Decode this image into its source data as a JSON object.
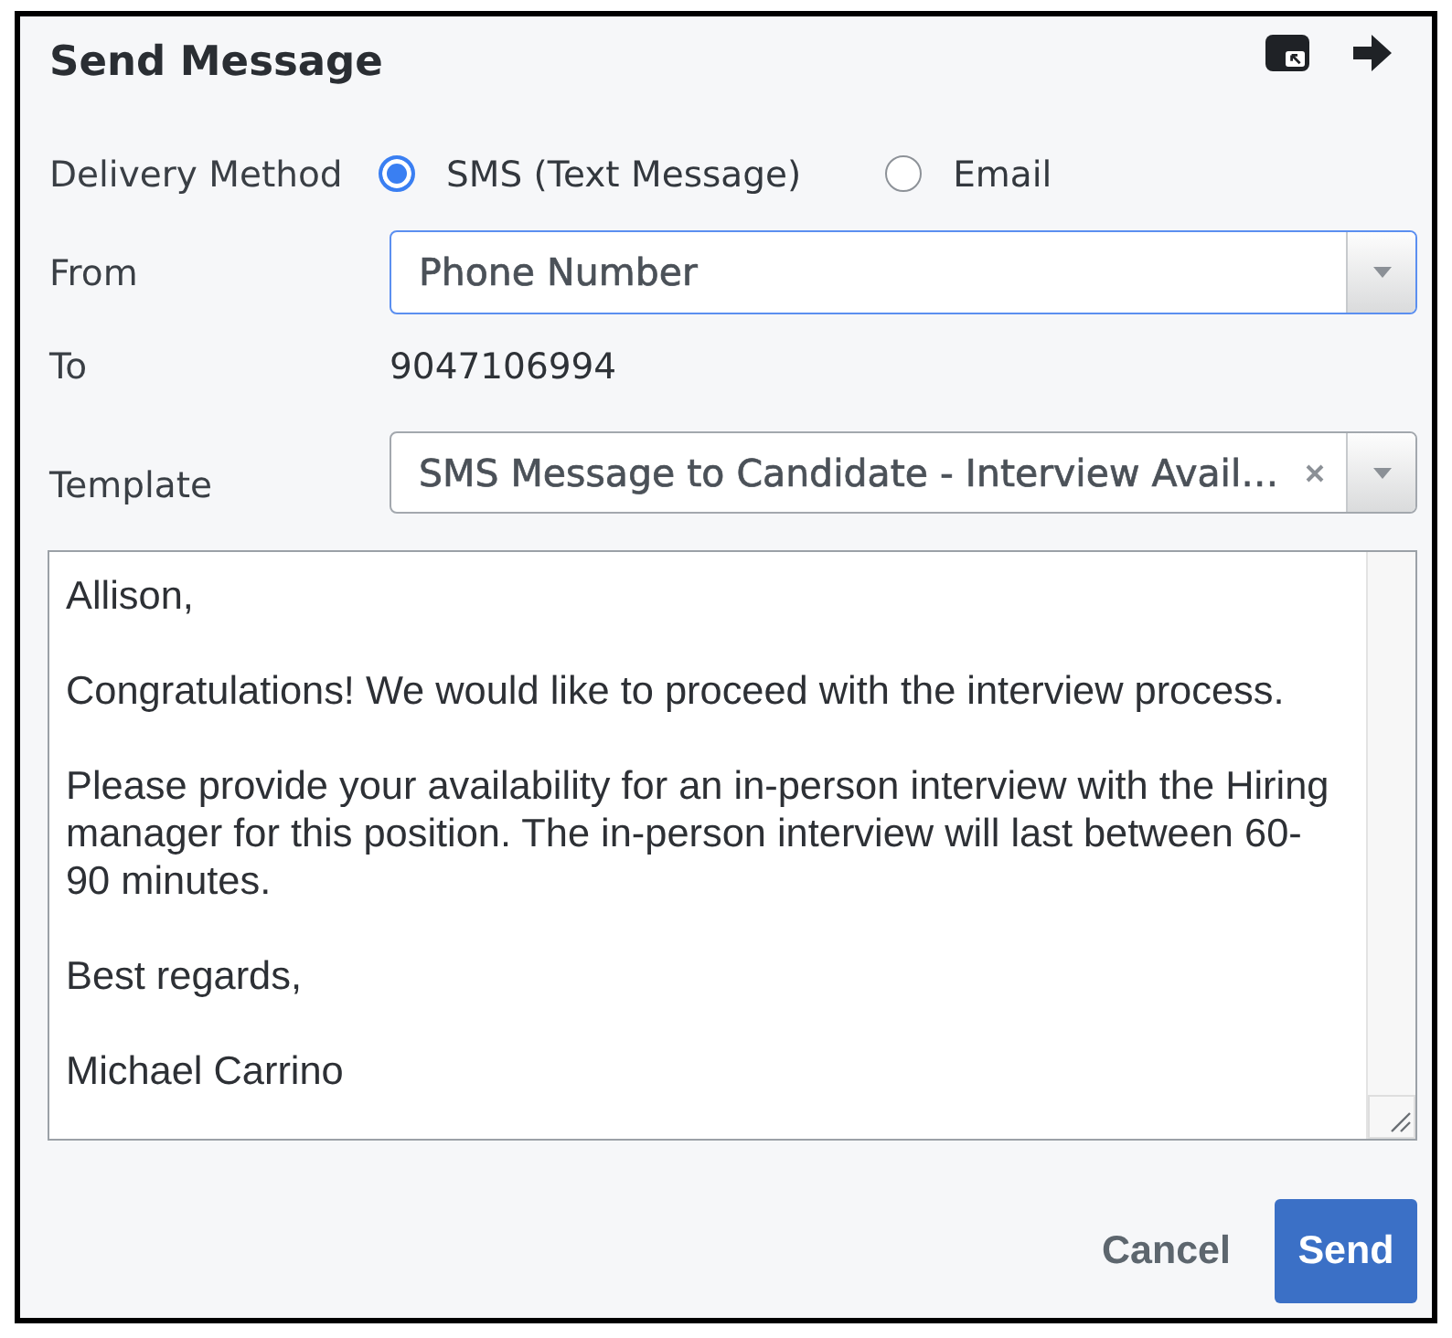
{
  "dialog": {
    "title": "Send Message"
  },
  "delivery_method": {
    "label": "Delivery Method",
    "options": [
      {
        "label": "SMS (Text Message)",
        "selected": true
      },
      {
        "label": "Email",
        "selected": false
      }
    ]
  },
  "from": {
    "label": "From",
    "value": "Phone Number",
    "focused": true
  },
  "to": {
    "label": "To",
    "value": "9047106994"
  },
  "template": {
    "label": "Template",
    "value": "SMS Message to Candidate - Interview Avail…",
    "clearable": true
  },
  "message": {
    "value": "Allison,\n\nCongratulations! We would like to proceed with the interview process.\n\nPlease provide your availability for an in-person interview with the Hiring manager for this position. The in-person interview will last between 60-90 minutes.\n\nBest regards,\n\nMichael Carrino"
  },
  "buttons": [
    {
      "label": "Cancel",
      "kind": "secondary"
    },
    {
      "label": "Send",
      "kind": "primary"
    }
  ]
}
